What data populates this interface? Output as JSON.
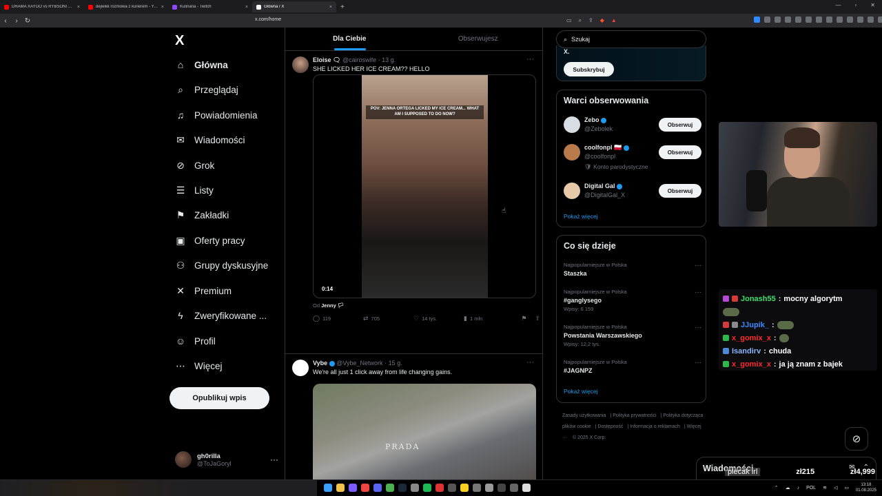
{
  "browser": {
    "tabs": [
      {
        "title": "DRAMA XAYOO vs RYBSONI BAGIETA",
        "color": "#ff0000"
      },
      {
        "title": "dejwikk rozmowa z kurierem - YouTube",
        "color": "#ff0000"
      },
      {
        "title": "Kulinaria - Twitch",
        "color": "#9146ff"
      },
      {
        "title": "Główna / X",
        "color": "#ffffff",
        "active": true
      }
    ],
    "url": "x.com/home"
  },
  "sidebar": {
    "logo": "X",
    "items": [
      {
        "label": "Główna",
        "icon": "home-icon",
        "glyph": "⌂",
        "active": true
      },
      {
        "label": "Przeglądaj",
        "icon": "search-icon",
        "glyph": "⌕"
      },
      {
        "label": "Powiadomienia",
        "icon": "bell-icon",
        "glyph": "♫"
      },
      {
        "label": "Wiadomości",
        "icon": "mail-icon",
        "glyph": "✉"
      },
      {
        "label": "Grok",
        "icon": "grok-icon",
        "glyph": "⊘"
      },
      {
        "label": "Listy",
        "icon": "list-icon",
        "glyph": "☰"
      },
      {
        "label": "Zakładki",
        "icon": "bookmark-icon",
        "glyph": "⚑"
      },
      {
        "label": "Oferty pracy",
        "icon": "briefcase-icon",
        "glyph": "▣"
      },
      {
        "label": "Grupy dyskusyjne",
        "icon": "people-icon",
        "glyph": "⚇"
      },
      {
        "label": "Premium",
        "icon": "x-premium-icon",
        "glyph": "✕"
      },
      {
        "label": "Zweryfikowane ...",
        "icon": "lightning-icon",
        "glyph": "ϟ"
      },
      {
        "label": "Profil",
        "icon": "profile-icon",
        "glyph": "☺"
      },
      {
        "label": "Więcej",
        "icon": "more-circle-icon",
        "glyph": "⋯"
      }
    ],
    "post_button": "Opublikuj wpis",
    "profile": {
      "name": "gh0rilla",
      "handle": "@ToJaGoryl"
    }
  },
  "feed": {
    "tabs": [
      "Dla Ciebie",
      "Obserwujesz"
    ],
    "posts": [
      {
        "name": "Eloise 🗨",
        "handle": "@cairoswife",
        "time": "13 g.",
        "text": "SHE LICKED HER ICE CREAM?? HELLO",
        "video_caption": "POV: JENNA ORTEGA LICKED MY ICE CREAM... WHAT AM I SUPPOSED TO DO NOW?",
        "video_time": "0:14",
        "from_label": "Od",
        "from_name": "Jenny 🏳",
        "replies": "119",
        "reposts": "705",
        "likes": "14 tys.",
        "views": "1 mln"
      },
      {
        "name": "Vybe",
        "handle": "@Vybe_Network",
        "time": "15 g.",
        "text": "We're all just 1 click away from life changing gains.",
        "shirt_text": "PRADA"
      }
    ]
  },
  "right": {
    "search_placeholder": "Szukaj",
    "premium_tail": "X.",
    "subscribe": "Subskrybuj",
    "who_to_follow": {
      "title": "Warci obserwowania",
      "items": [
        {
          "name": "Zebo",
          "handle": "@Zebolek",
          "note": "",
          "avatar": "#d7dde3"
        },
        {
          "name": "coolfonpl 🇵🇱",
          "handle": "@coolfonpl",
          "note": "🛡 Konto parodystyczne",
          "avatar": "#b87a4a"
        },
        {
          "name": "Digital Gal",
          "handle": "@DigitalGal_X",
          "note": "",
          "avatar": "#e6c9a8"
        }
      ],
      "follow_label": "Obserwuj",
      "more": "Pokaż więcej"
    },
    "trends": {
      "title": "Co się dzieje",
      "items": [
        {
          "meta": "Najpopularniejsze w Polska",
          "name": "Staszka",
          "count": ""
        },
        {
          "meta": "Najpopularniejsze w Polska",
          "name": "#ganglysego",
          "count": "Wpisy: 6 159"
        },
        {
          "meta": "Najpopularniejsze w Polska",
          "name": "Powstania Warszawskiego",
          "count": "Wpisy: 12,2 tys."
        },
        {
          "meta": "Najpopularniejsze w Polska",
          "name": "#JAGNPZ",
          "count": ""
        }
      ],
      "more": "Pokaż więcej"
    },
    "footer": [
      "Zasady użytkowania",
      "Polityka prywatności",
      "Polityka dotycząca plików cookie",
      "Dostępność",
      "Informacja o reklamach",
      "Więcej ···",
      "© 2025 X Corp."
    ]
  },
  "stream": {
    "chat": [
      {
        "user": "Jonash55",
        "color": "#3ee06b",
        "msg": "mocny algorytm"
      },
      {
        "user": "JJupik_",
        "color": "#3b8bff",
        "msg": ""
      },
      {
        "user": "x_gomix_x",
        "color": "#ff2b2b",
        "msg": ""
      },
      {
        "user": "Isandirv",
        "color": "#8ab4ff",
        "msg": "chuda"
      },
      {
        "user": "x_gomix_x",
        "color": "#ff2b2b",
        "msg": "ja ją znam z bajek"
      }
    ],
    "ticker": [
      "plecak irl",
      "zł215",
      "zł4,999"
    ]
  },
  "messages_drawer": {
    "title": "Wiadomości"
  },
  "taskbar": {
    "lang": "POL",
    "time": "13:18",
    "date": "01.08.2025"
  }
}
